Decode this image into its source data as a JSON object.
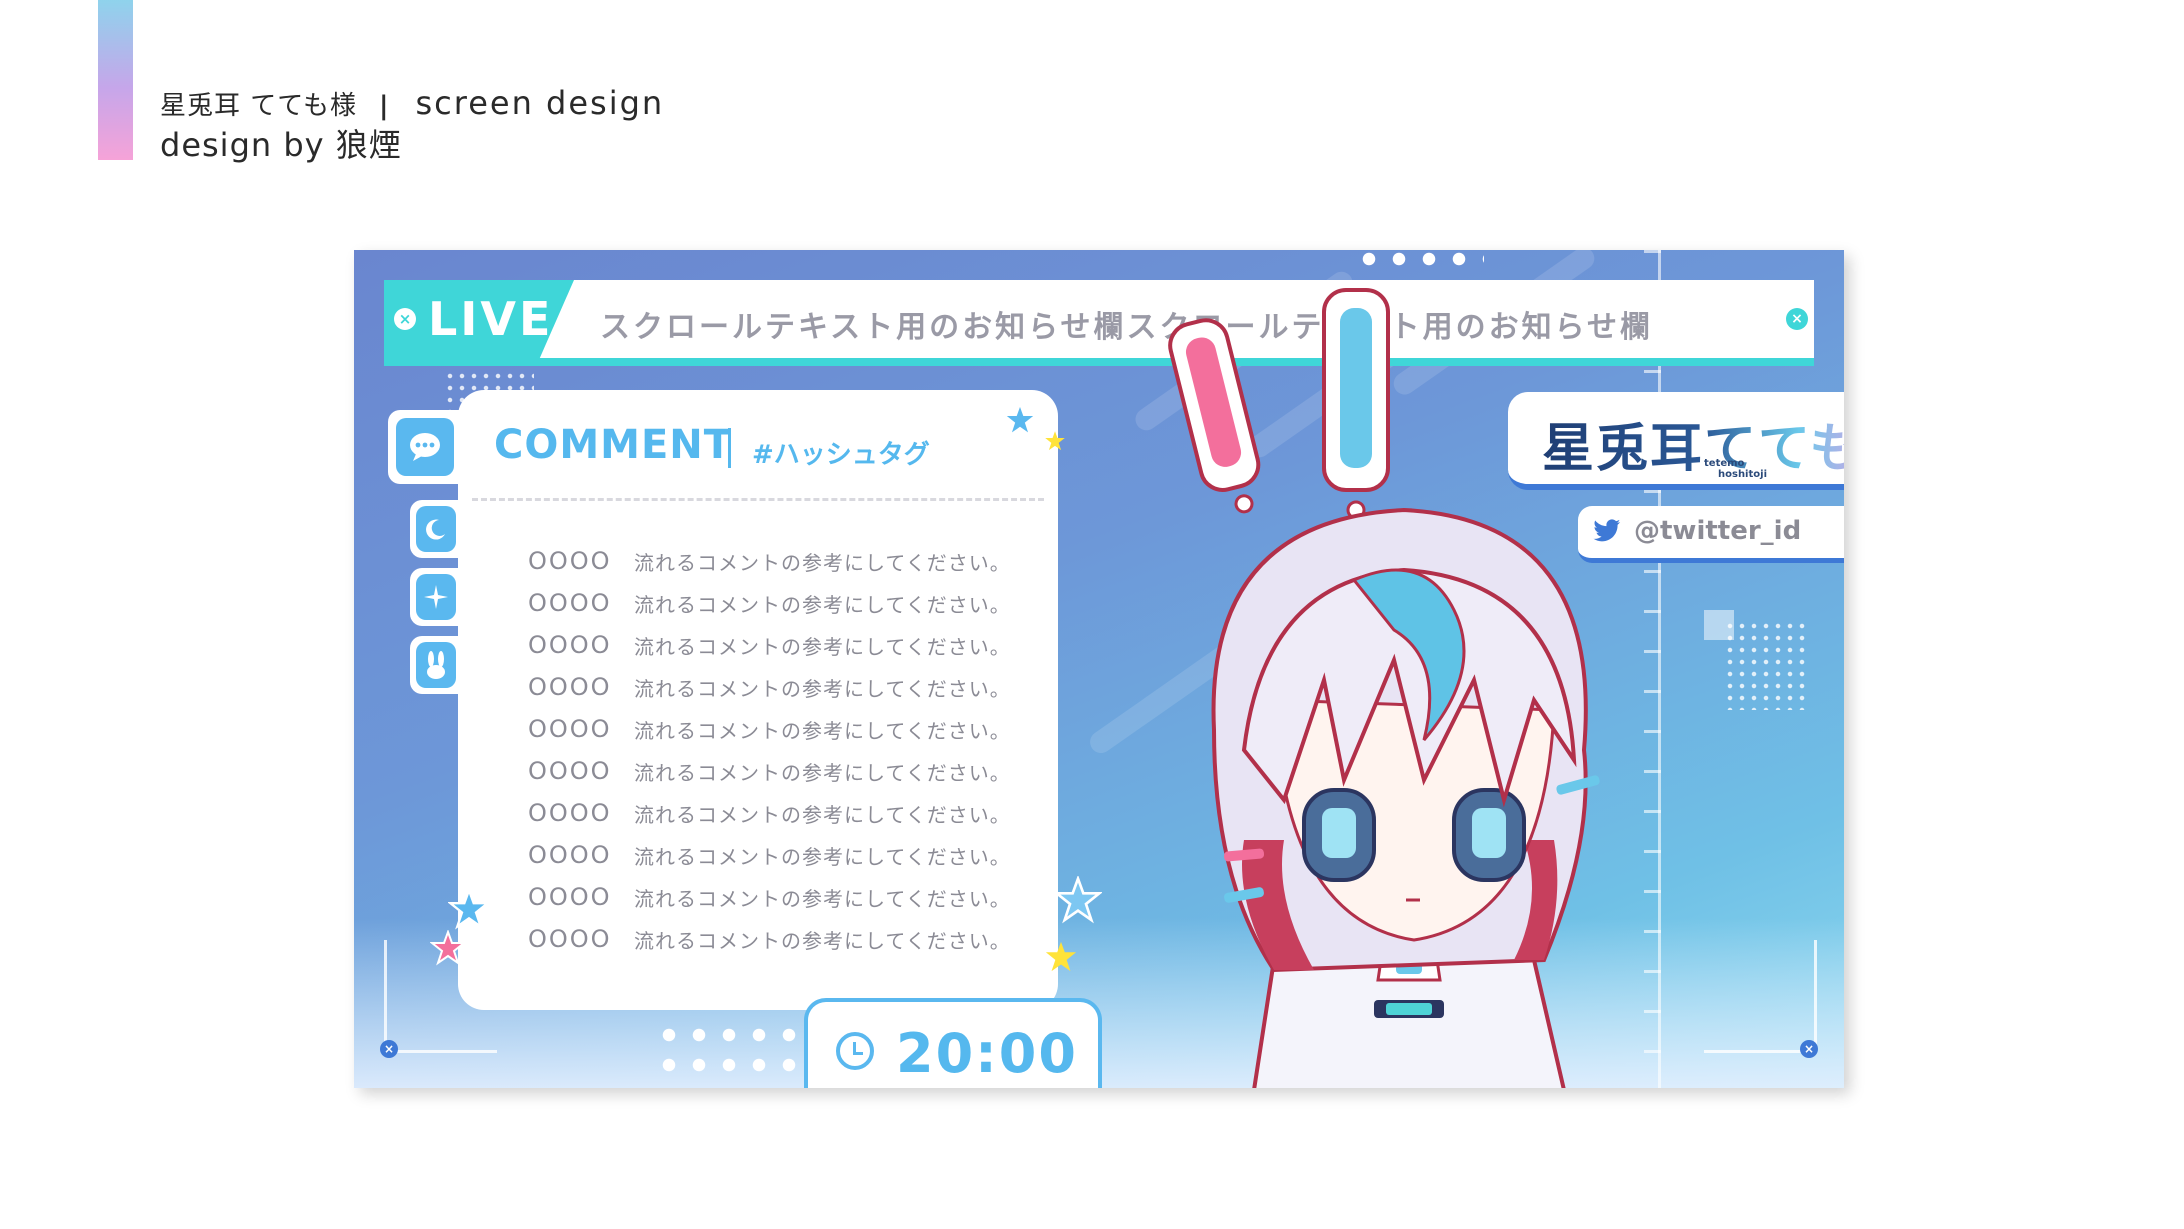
{
  "header": {
    "client_name": "星兎耳 てても様",
    "separator": "|",
    "project_type": "screen design",
    "credit": "design by 狼煙"
  },
  "ticker": {
    "live_label": "LIVE",
    "scroll_text": "スクロールテキスト用のお知らせ欄スクロールテキスト用のお知らせ欄"
  },
  "comment_panel": {
    "title": "COMMENT",
    "hashtag": "#ハッシュタグ",
    "rows": [
      {
        "name": "OOOO",
        "message": "流れるコメントの参考にしてください。"
      },
      {
        "name": "OOOO",
        "message": "流れるコメントの参考にしてください。"
      },
      {
        "name": "OOOO",
        "message": "流れるコメントの参考にしてください。"
      },
      {
        "name": "OOOO",
        "message": "流れるコメントの参考にしてください。"
      },
      {
        "name": "OOOO",
        "message": "流れるコメントの参考にしてください。"
      },
      {
        "name": "OOOO",
        "message": "流れるコメントの参考にしてください。"
      },
      {
        "name": "OOOO",
        "message": "流れるコメントの参考にしてください。"
      },
      {
        "name": "OOOO",
        "message": "流れるコメントの参考にしてください。"
      },
      {
        "name": "OOOO",
        "message": "流れるコメントの参考にしてください。"
      },
      {
        "name": "OOOO",
        "message": "流れるコメントの参考にしてください。"
      }
    ]
  },
  "clock": {
    "time": "20:00"
  },
  "name_plate": {
    "name": "星兎耳てても",
    "romaji_line1": "tetemo",
    "romaji_line2": "hoshitoji"
  },
  "twitter": {
    "handle": "@twitter_id"
  },
  "side_icons": [
    "chat-bubble-icon",
    "moon-icon",
    "sparkle-icon",
    "rabbit-icon"
  ],
  "colors": {
    "accent_teal": "#3fd6d8",
    "accent_blue": "#55b8ee",
    "deep_blue": "#3e79d6",
    "pink": "#f36f9c",
    "yellow": "#ffe33a"
  }
}
